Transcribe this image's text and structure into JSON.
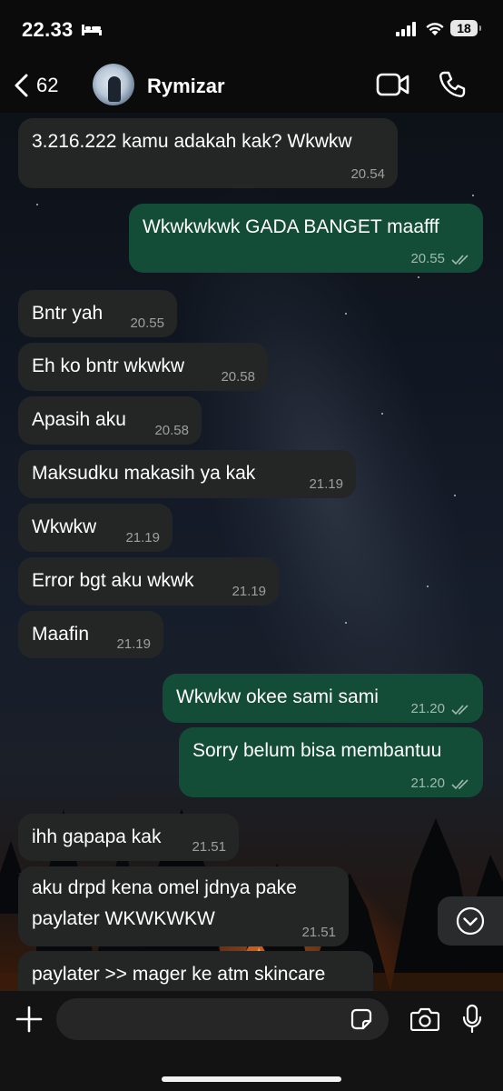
{
  "status_bar": {
    "time": "22.33",
    "battery": "18"
  },
  "header": {
    "back_count": "62",
    "contact_name": "Rymizar"
  },
  "messages": [
    {
      "direction": "in",
      "text": "3.216.222 kamu adakah kak? Wkwkw",
      "time": "20.54"
    },
    {
      "direction": "out",
      "text": "Wkwkwkwk GADA BANGET maafff",
      "time": "20.55",
      "read": true
    },
    {
      "direction": "in",
      "text": "Bntr yah",
      "time": "20.55"
    },
    {
      "direction": "in",
      "text": "Eh ko bntr wkwkw",
      "time": "20.58"
    },
    {
      "direction": "in",
      "text": "Apasih aku",
      "time": "20.58"
    },
    {
      "direction": "in",
      "text": "Maksudku makasih ya kak",
      "time": "21.19"
    },
    {
      "direction": "in",
      "text": "Wkwkw",
      "time": "21.19"
    },
    {
      "direction": "in",
      "text": "Error bgt aku wkwk",
      "time": "21.19"
    },
    {
      "direction": "in",
      "text": "Maafin",
      "time": "21.19"
    },
    {
      "direction": "out",
      "text": "Wkwkw okee sami sami",
      "time": "21.20",
      "read": true
    },
    {
      "direction": "out",
      "text": "Sorry belum bisa membantuu",
      "time": "21.20",
      "read": true
    },
    {
      "direction": "in",
      "text": "ihh gapapa kak",
      "time": "21.51"
    },
    {
      "direction": "in",
      "text": "aku drpd kena omel jdnya pake",
      "text_line2": "paylater WKWKWKW",
      "time": "21.51"
    },
    {
      "direction": "in",
      "text": "paylater >> mager ke atm skincare",
      "time": ""
    }
  ],
  "composer": {
    "placeholder": ""
  },
  "colors": {
    "incoming_bubble": "#242626",
    "outgoing_bubble": "#134d37",
    "read_receipt": "#9fb8ad"
  },
  "icons": [
    "bed-icon",
    "signal-icon",
    "wifi-icon",
    "back-chevron-icon",
    "video-call-icon",
    "phone-call-icon",
    "read-receipt-icon",
    "chevron-down-icon",
    "plus-icon",
    "sticker-icon",
    "camera-icon",
    "mic-icon"
  ]
}
